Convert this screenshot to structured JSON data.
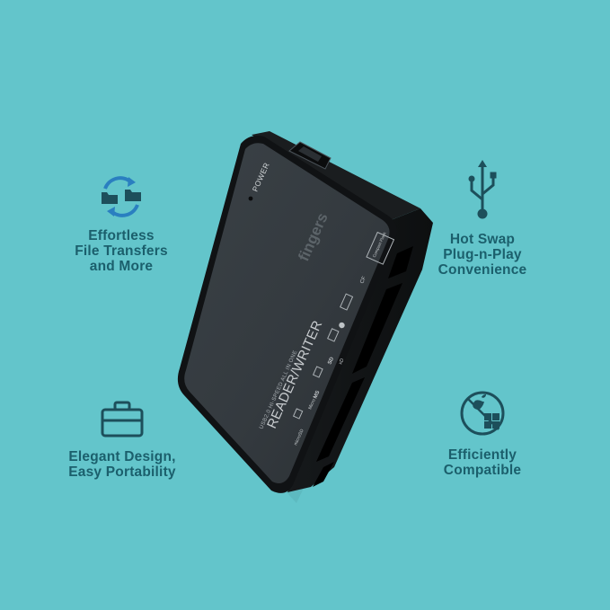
{
  "colors": {
    "background": "#63c5cb",
    "feature_text": "#1b5f6c",
    "icon_blue": "#2a7fc0",
    "icon_dark": "#1d4f5b",
    "device_body": "#2d3337",
    "device_edge": "#111416"
  },
  "features": [
    {
      "icon": "folder-sync-icon",
      "lines": [
        "Effortless",
        "File Transfers",
        "and More"
      ]
    },
    {
      "icon": "usb-icon",
      "lines": [
        "Hot Swap",
        "Plug-n-Play",
        "Convenience"
      ]
    },
    {
      "icon": "briefcase-icon",
      "lines": [
        "Elegant Design,",
        "Easy Portability"
      ]
    },
    {
      "icon": "os-compat-icon",
      "lines": [
        "Efficiently",
        "Compatible"
      ]
    }
  ],
  "device": {
    "power_label": "POWER",
    "brand": "fingers",
    "subtitle": "USB2.0 HI-SPEED ALL IN ONE",
    "title": "READER/WRITER",
    "slot_labels": {
      "cf": "CF",
      "compact_flash": "Compact Flash",
      "ms": "MS",
      "micro": "Micro",
      "micro_sd": "microSD",
      "sd": "SD",
      "xd": "xD"
    }
  }
}
